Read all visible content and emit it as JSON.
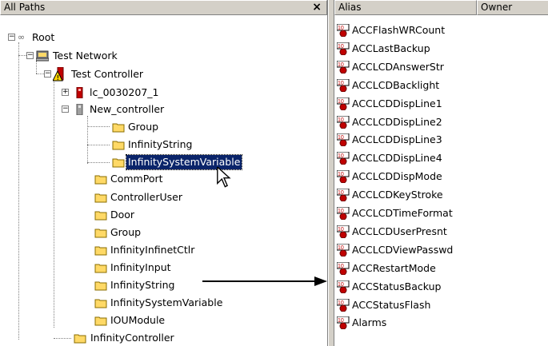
{
  "left_pane": {
    "header": "All Paths",
    "close": "×"
  },
  "tree": {
    "root": "Root",
    "test_network": "Test Network",
    "test_controller": "Test Controller",
    "lc": "lc_0030207_1",
    "new_controller": "New_controller",
    "group_sub": "Group",
    "infinity_string_sub": "InfinityString",
    "infinity_system_variable_sub": "InfinitySystemVariable",
    "comm_port": "CommPort",
    "controller_user": "ControllerUser",
    "door": "Door",
    "group": "Group",
    "infinity_infinet_ctlr": "InfinityInfinetCtlr",
    "infinity_input": "InfinityInput",
    "infinity_string": "InfinityString",
    "infinity_system_variable": "InfinitySystemVariable",
    "iou_module": "IOUModule",
    "infinity_controller": "InfinityController"
  },
  "right_pane": {
    "columns": [
      "Alias",
      "Owner"
    ],
    "rows": [
      "ACCFlashWRCount",
      "ACCLastBackup",
      "ACCLCDAnswerStr",
      "ACCLCDBacklight",
      "ACCLCDDispLine1",
      "ACCLCDDispLine2",
      "ACCLCDDispLine3",
      "ACCLCDDispLine4",
      "ACCLCDDispMode",
      "ACCLCDKeyStroke",
      "ACCLCDTimeFormat",
      "ACCLCDUserPresnt",
      "ACCLCDViewPasswd",
      "ACCRestartMode",
      "ACCStatusBackup",
      "ACCStatusFlash",
      "Alarms"
    ]
  },
  "icons": {
    "folder": "folder-icon",
    "network": "network-icon",
    "controller": "controller-icon",
    "variable": "system-variable-icon"
  },
  "colors": {
    "selection": "#0a246a",
    "folder": "#ffd966",
    "chrome": "#d4d0c8"
  }
}
